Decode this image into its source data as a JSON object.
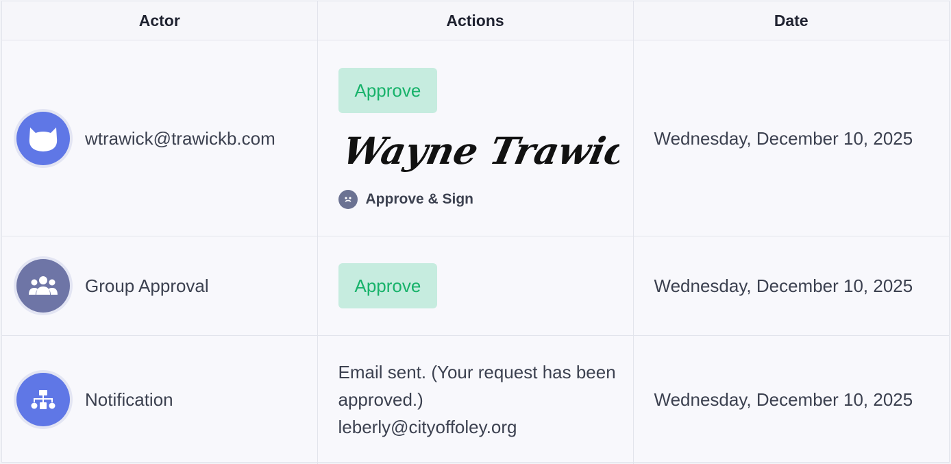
{
  "table": {
    "headers": {
      "actor": "Actor",
      "actions": "Actions",
      "date": "Date"
    },
    "rows": [
      {
        "actor": "wtrawick@trawickb.com",
        "avatar_icon": "cat-face-icon",
        "approve_label": "Approve",
        "signature_text": "Wayne Trawick",
        "sign_method": "Approve & Sign",
        "date": "Wednesday, December 10, 2025"
      },
      {
        "actor": "Group Approval",
        "avatar_icon": "group-users-icon",
        "approve_label": "Approve",
        "date": "Wednesday, December 10, 2025"
      },
      {
        "actor": "Notification",
        "avatar_icon": "sitemap-icon",
        "email_line1": "Email sent. (Your request has been approved.)",
        "email_line2": "leberly@cityoffoley.org",
        "date": "Wednesday, December 10, 2025"
      }
    ]
  },
  "colors": {
    "approve_bg": "#c6ecdf",
    "approve_text": "#17b26a",
    "avatar_blue": "#5f77e6",
    "avatar_gray": "#6e75a6"
  }
}
